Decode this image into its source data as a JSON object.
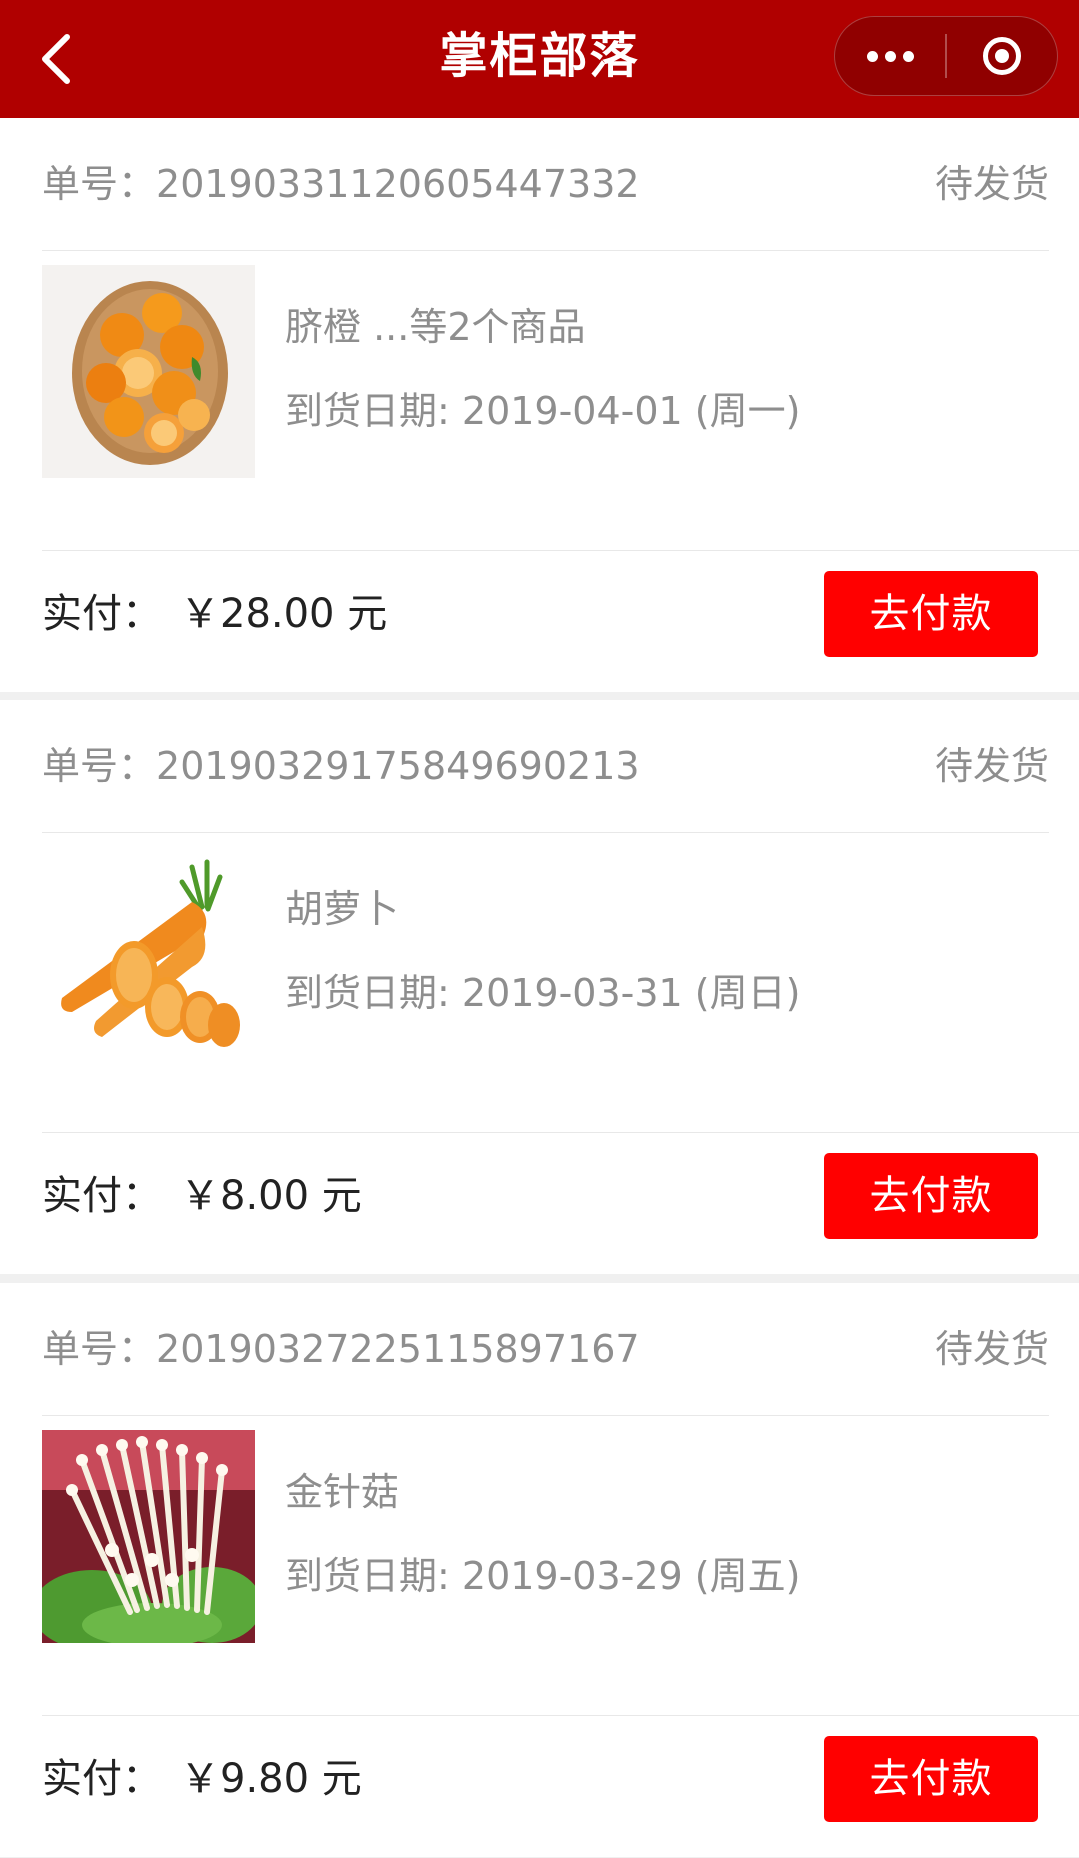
{
  "header": {
    "title": "掌柜部落"
  },
  "orders": [
    {
      "order_label": "单号：",
      "order_no": "20190331120605447332",
      "status": "待发货",
      "item_name": "脐橙 ...等2个商品",
      "date_label": "到货日期: ",
      "date_value": "2019-04-01 (周一)",
      "paid_label": "实付：",
      "amount": "￥28.00 元",
      "pay_button": "去付款",
      "thumb_icon": "orange-basket-image"
    },
    {
      "order_label": "单号：",
      "order_no": "20190329175849690213",
      "status": "待发货",
      "item_name": "胡萝卜",
      "date_label": "到货日期: ",
      "date_value": "2019-03-31 (周日)",
      "paid_label": "实付：",
      "amount": "￥8.00 元",
      "pay_button": "去付款",
      "thumb_icon": "carrot-image"
    },
    {
      "order_label": "单号：",
      "order_no": "20190327225115897167",
      "status": "待发货",
      "item_name": "金针菇",
      "date_label": "到货日期: ",
      "date_value": "2019-03-29 (周五)",
      "paid_label": "实付：",
      "amount": "￥9.80 元",
      "pay_button": "去付款",
      "thumb_icon": "enoki-mushroom-image"
    }
  ],
  "colors": {
    "header_bg": "#b00000",
    "pay_button": "#ff0000",
    "muted_text": "#8e8e8e"
  }
}
